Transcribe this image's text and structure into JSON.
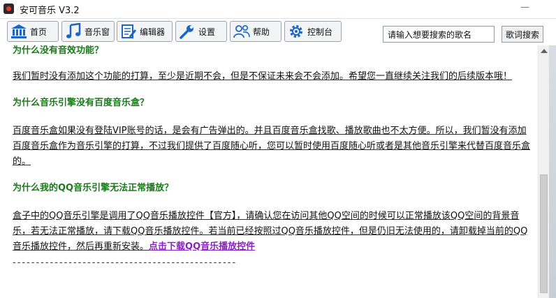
{
  "window": {
    "title": "安可音乐 V3.2"
  },
  "toolbar": {
    "tabs": [
      {
        "label": "首页",
        "icon": "bank-home-icon"
      },
      {
        "label": "音乐窗",
        "icon": "music-note-icon"
      },
      {
        "label": "编辑器",
        "icon": "editor-icon"
      },
      {
        "label": "设置",
        "icon": "wrench-icon"
      },
      {
        "label": "帮助",
        "icon": "people-icon"
      },
      {
        "label": "控制台",
        "icon": "gear-icon"
      }
    ],
    "search_value": "请输入想要搜索的歌名",
    "search_button": "歌词搜索"
  },
  "faq": [
    {
      "question": "为什么没有音效功能？",
      "answer": "我们暂时没有添加这个功能的打算，至少是近期不会，但是不保证未来会不会添加。希望您一直继续关注我们的后续版本哦！"
    },
    {
      "question": "为什么音乐引擎没有百度音乐盒？",
      "answer": "百度音乐盒如果没有登陆VIP账号的话，是会有广告弹出的。并且百度音乐盒找歌、播放歌曲也不太方便。所以，我们暂没有添加百度音乐盒作为音乐引擎的打算，不过我们提供了百度随心听，您可以暂时使用百度随心听或者是其他音乐引擎来代替百度音乐盒的。"
    },
    {
      "question": "为什么我的QQ音乐引擎无法正常播放？",
      "answer": "盒子中的QQ音乐引擎是调用了QQ音乐播放控件【官方】，请确认您在访问其他QQ空间的时候可以正常播放该QQ空间的背景音乐，若无法正常播放，请下载QQ音乐播放控件。若当前已经按照过QQ音乐播放控件，但是仍旧无法使用的，请卸载掉当前的QQ音乐播放控件，然后再重新安装。",
      "link": "点击下载QQ音乐播放控件"
    }
  ],
  "divider": "------------------------------------------------",
  "colors": {
    "question": "#1a7a1a",
    "link": "#8a1fc4"
  }
}
